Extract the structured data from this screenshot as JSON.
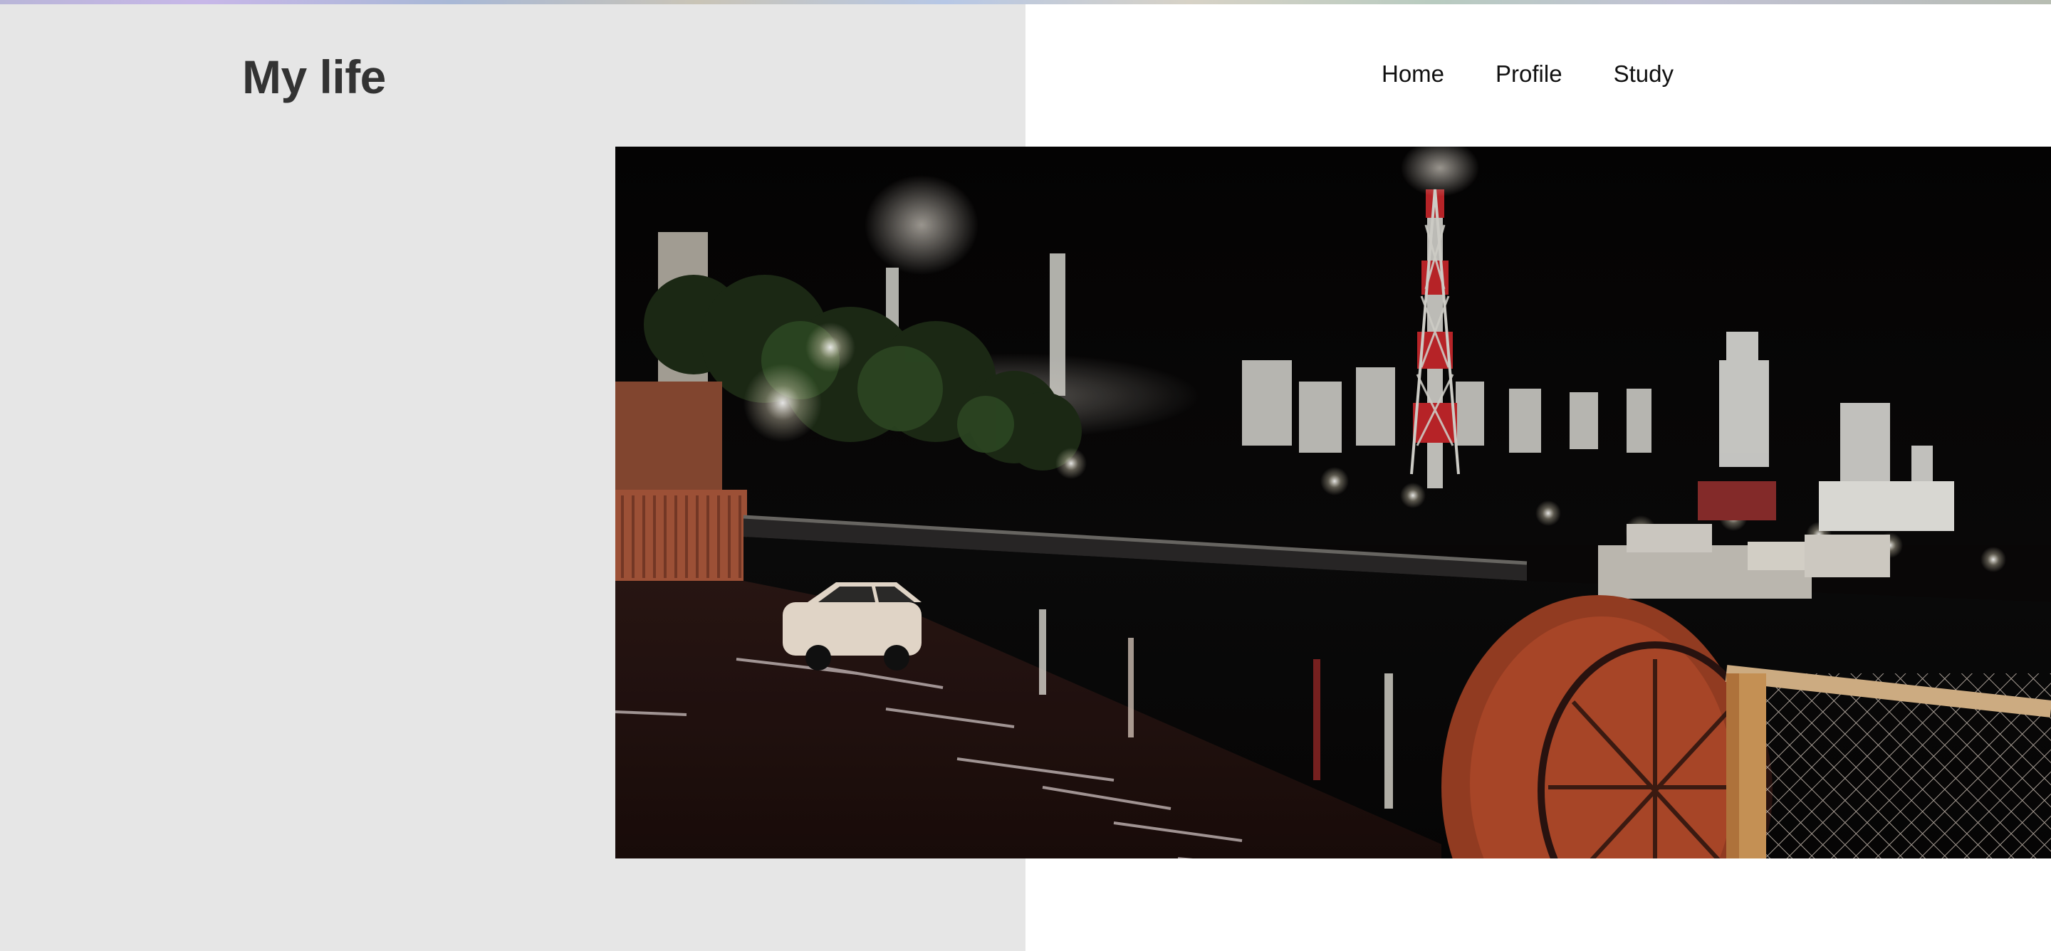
{
  "site": {
    "title": "My life"
  },
  "nav": {
    "items": [
      {
        "label": "Home"
      },
      {
        "label": "Profile"
      },
      {
        "label": "Study"
      }
    ]
  },
  "hero": {
    "image_semantic": "night-industrial-harbor-photo"
  },
  "colors": {
    "left_panel": "#e6e6e6",
    "title": "#333333",
    "nav_text": "#111111"
  }
}
